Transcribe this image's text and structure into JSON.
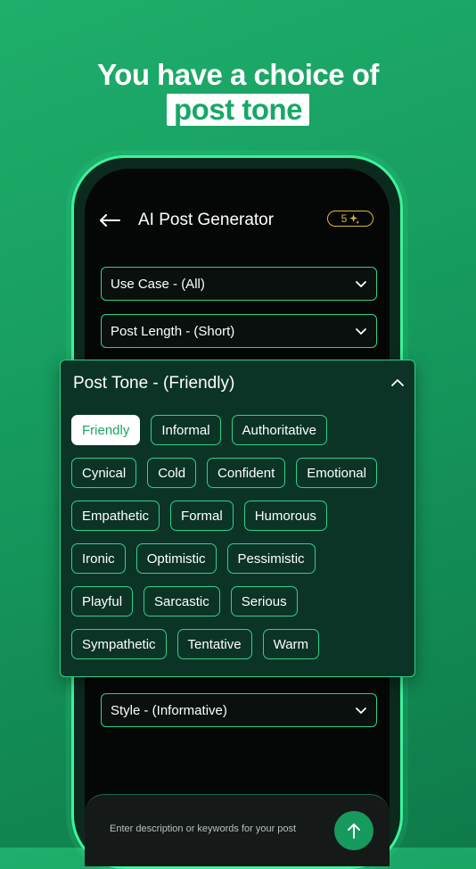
{
  "headline": {
    "line1": "You have a choice of",
    "highlight": "post tone"
  },
  "app": {
    "title": "AI Post Generator",
    "credits": "5",
    "back_icon": "arrow-left-icon",
    "sparkle_icon": "sparkle-icon"
  },
  "selects": {
    "use_case": "Use Case - (All)",
    "post_length": "Post Length - (Short)",
    "style": "Style - (Informative)"
  },
  "tone_panel": {
    "header": "Post Tone - (Friendly)",
    "selected": "Friendly",
    "rows": [
      [
        "Friendly",
        "Informal",
        "Authoritative"
      ],
      [
        "Cynical",
        "Cold",
        "Confident",
        "Emotional"
      ],
      [
        "Empathetic",
        "Formal",
        "Humorous"
      ],
      [
        "Ironic",
        "Optimistic",
        "Pessimistic"
      ],
      [
        "Playful",
        "Sarcastic",
        "Serious"
      ],
      [
        "Sympathetic",
        "Tentative",
        "Warm"
      ]
    ]
  },
  "composer": {
    "placeholder": "Enter description or keywords for your post"
  },
  "colors": {
    "accent": "#2fd187",
    "brand_green": "#169a5e",
    "credits_gold": "#e2b43b",
    "panel_bg": "#0b3426"
  }
}
